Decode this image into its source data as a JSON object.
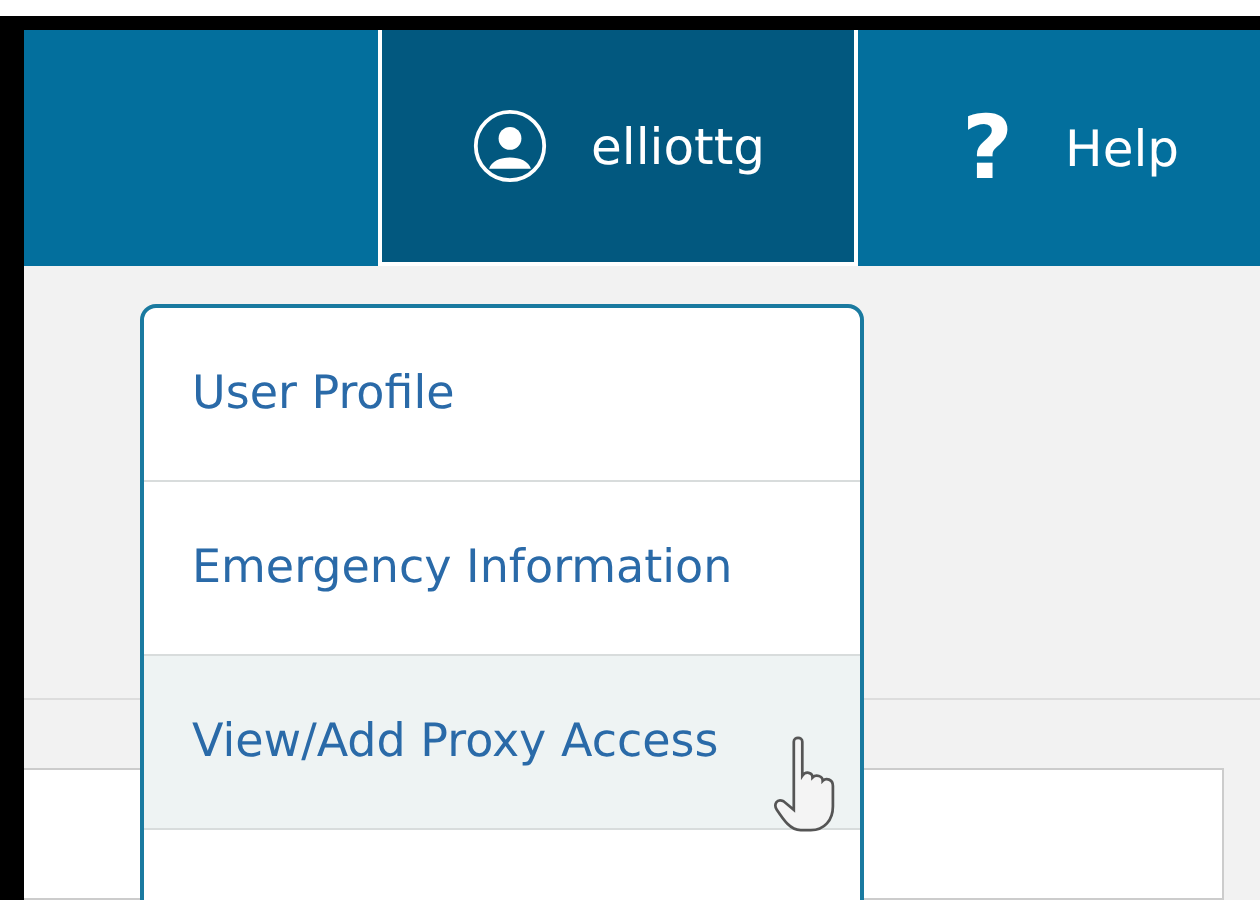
{
  "header": {
    "user": {
      "name": "elliottg",
      "selected": true
    },
    "help": {
      "label": "Help",
      "icon_text": "?"
    }
  },
  "user_menu": {
    "items": [
      {
        "label": "User Profile",
        "selected": false
      },
      {
        "label": "Emergency Information",
        "selected": false
      },
      {
        "label": "View/Add Proxy Access",
        "selected": true
      }
    ]
  }
}
